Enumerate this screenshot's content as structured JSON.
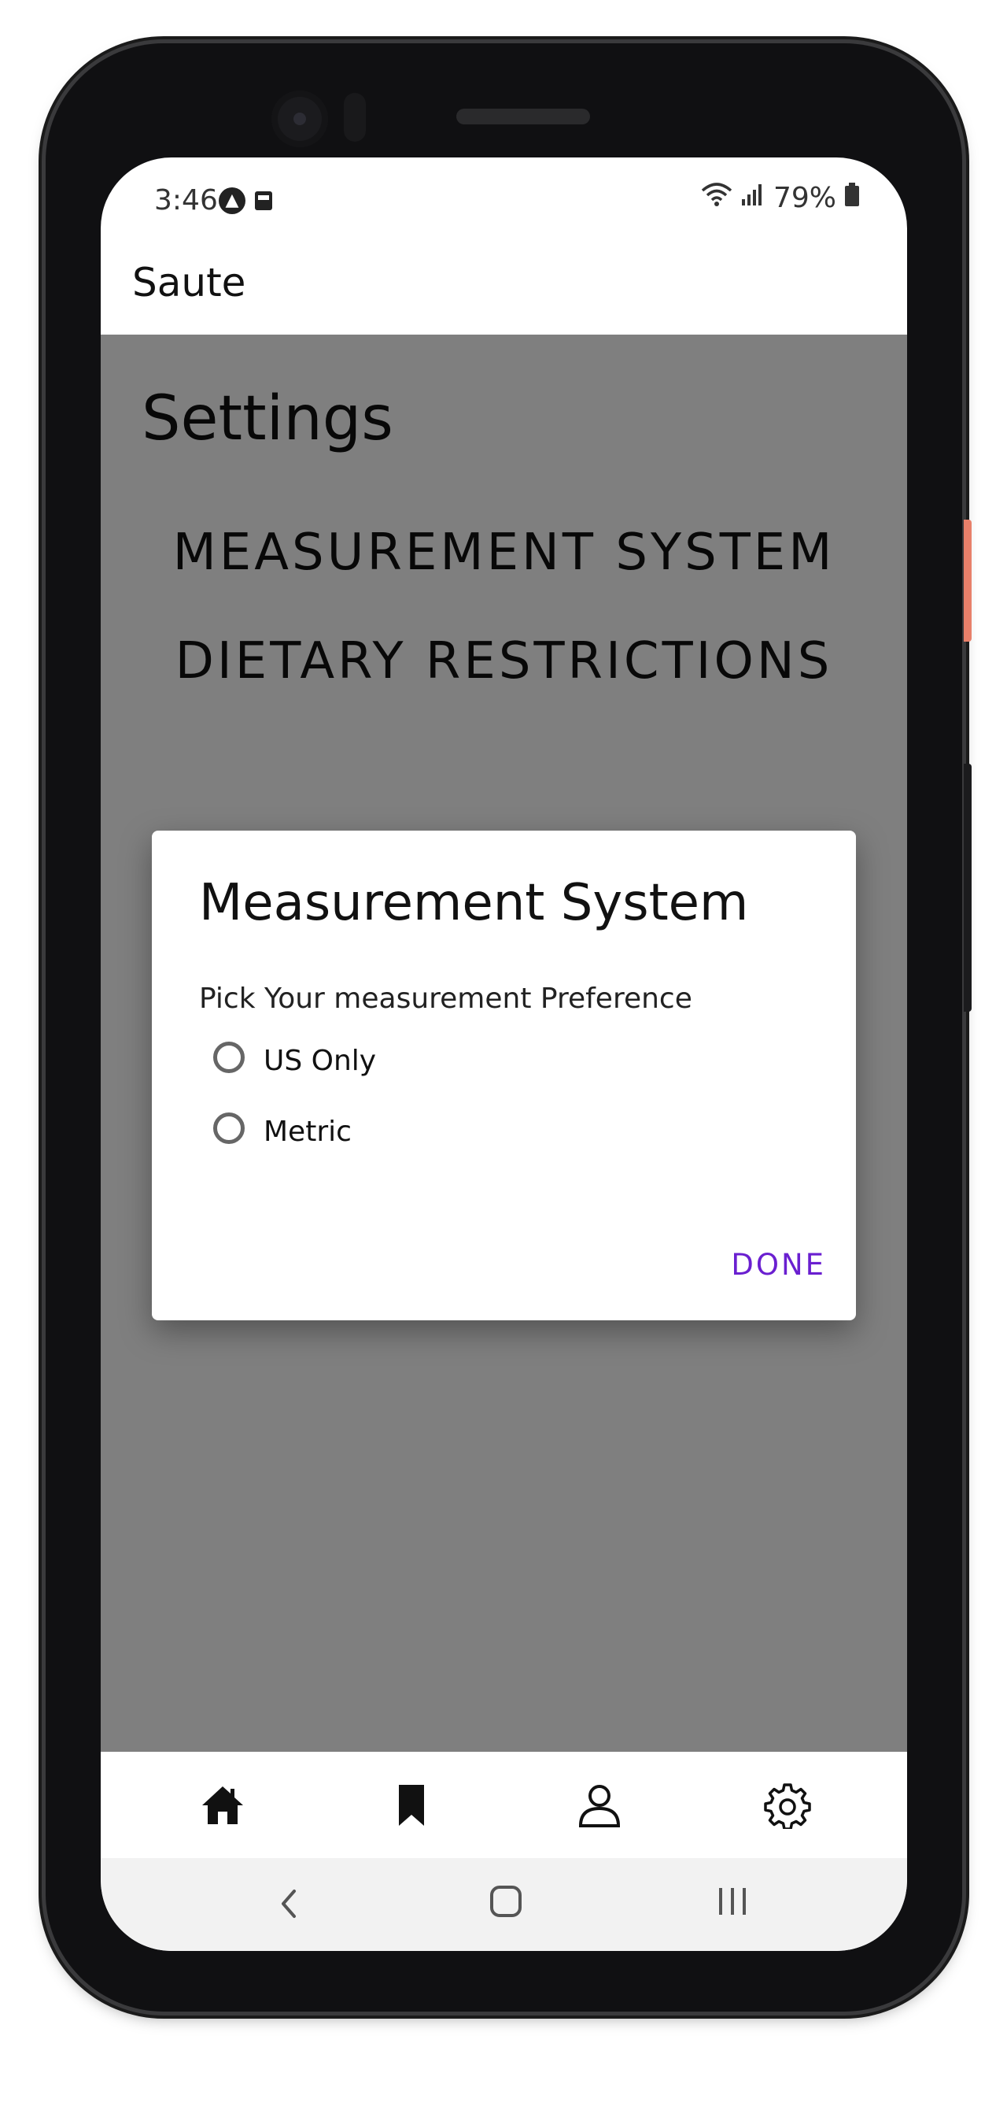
{
  "status_bar": {
    "time": "3:46",
    "battery": "79%",
    "icons": [
      "a-notification-icon",
      "card-notification-icon",
      "wifi-icon",
      "signal-icon",
      "battery-icon"
    ]
  },
  "app_bar": {
    "title": "Saute"
  },
  "settings": {
    "title": "Settings",
    "items": [
      {
        "label": "MEASUREMENT SYSTEM"
      },
      {
        "label": "DIETARY RESTRICTIONS"
      }
    ]
  },
  "dialog": {
    "title": "Measurement System",
    "subtitle": "Pick Your measurement Preference",
    "options": [
      {
        "label": "US Only",
        "selected": false
      },
      {
        "label": "Metric",
        "selected": false
      }
    ],
    "done_label": "DONE",
    "accent_color": "#6a1fd0"
  },
  "bottom_nav": {
    "items": [
      {
        "icon": "home-icon",
        "active": true
      },
      {
        "icon": "bookmark-icon",
        "active": false
      },
      {
        "icon": "profile-icon",
        "active": false
      },
      {
        "icon": "gear-icon",
        "active": false
      }
    ]
  },
  "system_nav": {
    "icons": [
      "back-icon",
      "home-circle-icon",
      "recents-icon"
    ]
  }
}
